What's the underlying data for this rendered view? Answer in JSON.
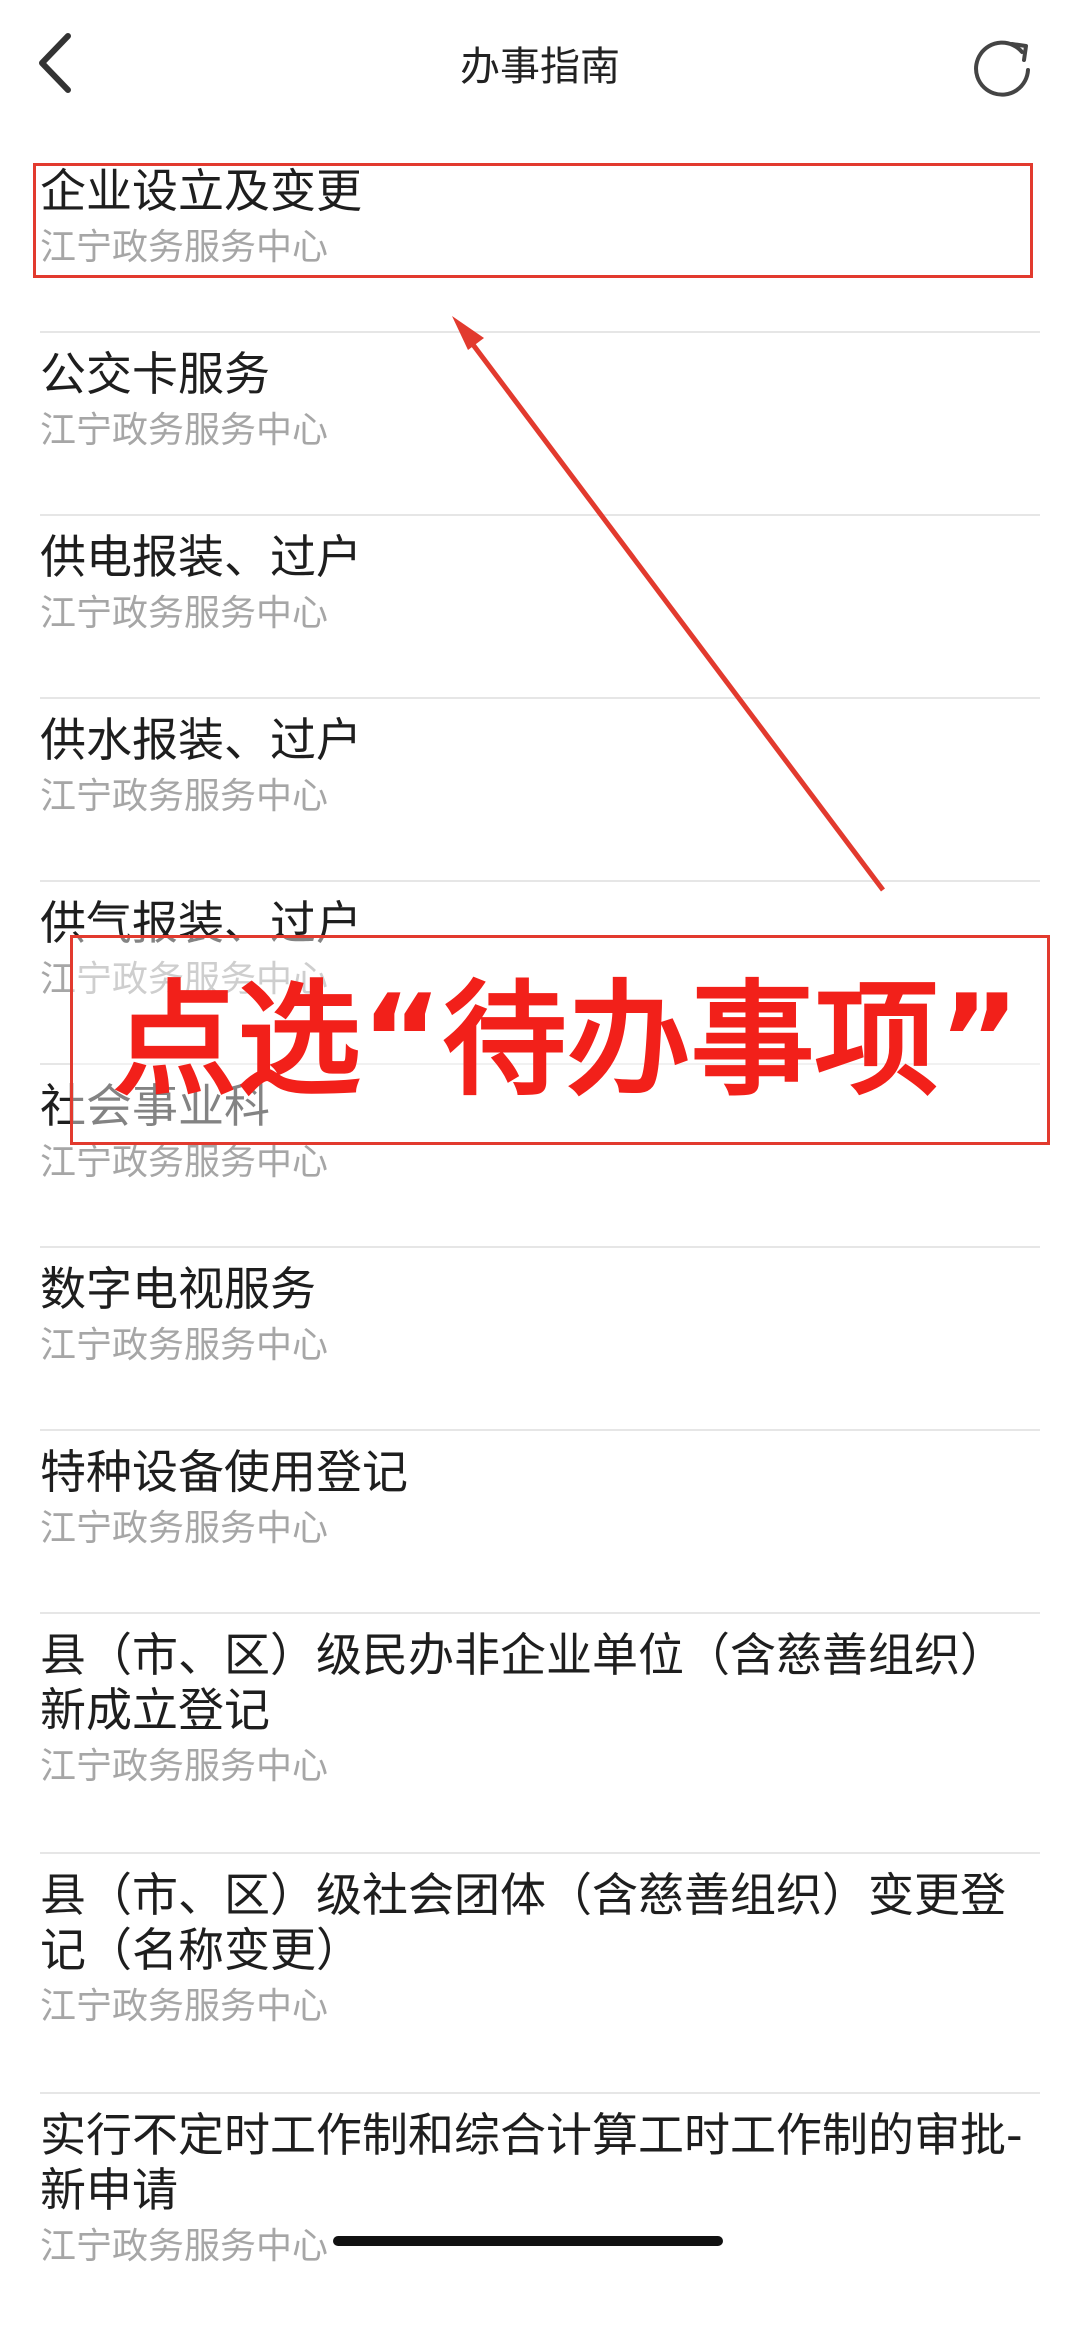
{
  "header": {
    "title": "办事指南",
    "back_icon": "chevron-left-icon",
    "refresh_icon": "refresh-icon"
  },
  "items": [
    {
      "title": "企业设立及变更",
      "subtitle": "江宁政务服务中心"
    },
    {
      "title": "公交卡服务",
      "subtitle": "江宁政务服务中心"
    },
    {
      "title": "供电报装、过户",
      "subtitle": "江宁政务服务中心"
    },
    {
      "title": "供水报装、过户",
      "subtitle": "江宁政务服务中心"
    },
    {
      "title": "供气报装、过户",
      "subtitle": "江宁政务服务中心"
    },
    {
      "title": "社会事业科",
      "subtitle": "江宁政务服务中心"
    },
    {
      "title": "数字电视服务",
      "subtitle": "江宁政务服务中心"
    },
    {
      "title": "特种设备使用登记",
      "subtitle": "江宁政务服务中心"
    },
    {
      "title": "县（市、区）级民办非企业单位（含慈善组织）新成立登记",
      "subtitle": "江宁政务服务中心"
    },
    {
      "title": "县（市、区）级社会团体（含慈善组织）变更登记（名称变更）",
      "subtitle": "江宁政务服务中心"
    },
    {
      "title": "实行不定时工作制和综合计算工时工作制的审批-新申请",
      "subtitle": "江宁政务服务中心"
    }
  ],
  "annotation": {
    "callout_text": "点选“待办事项”",
    "color": "#e23a2e"
  }
}
